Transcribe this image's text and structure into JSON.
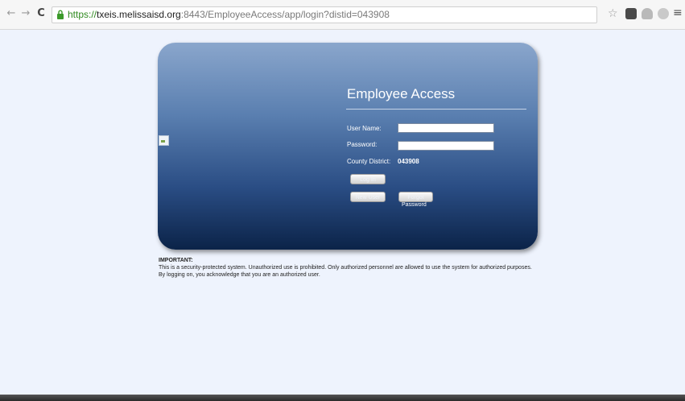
{
  "browser": {
    "url_scheme": "https://",
    "url_host": "txeis.melissaisd.org",
    "url_rest": ":8443/EmployeeAccess/app/login?distid=043908",
    "back_icon": "←",
    "forward_icon": "→",
    "reload_icon": "C",
    "star_icon": "☆",
    "menu_icon": "≡"
  },
  "login": {
    "title": "Employee Access",
    "username_label": "User Name:",
    "password_label": "Password:",
    "district_label": "County District:",
    "district_value": "043908",
    "username_value": "",
    "password_value": "",
    "login_button": "Log In",
    "new_user_button": "New User",
    "forgot_button": "Forgot",
    "forgot_button_sub": "Password"
  },
  "notice": {
    "heading": "IMPORTANT:",
    "body": "This is a security-protected system. Unauthorized use is prohibited. Only authorized personnel are allowed to use the system for authorized purposes. By logging on, you acknowledge that you are an authorized user."
  },
  "colors": {
    "page_bg": "#eef3fd",
    "card_top": "#8aa6cc",
    "card_bottom": "#0b2348",
    "url_green": "#2f8a1f"
  }
}
